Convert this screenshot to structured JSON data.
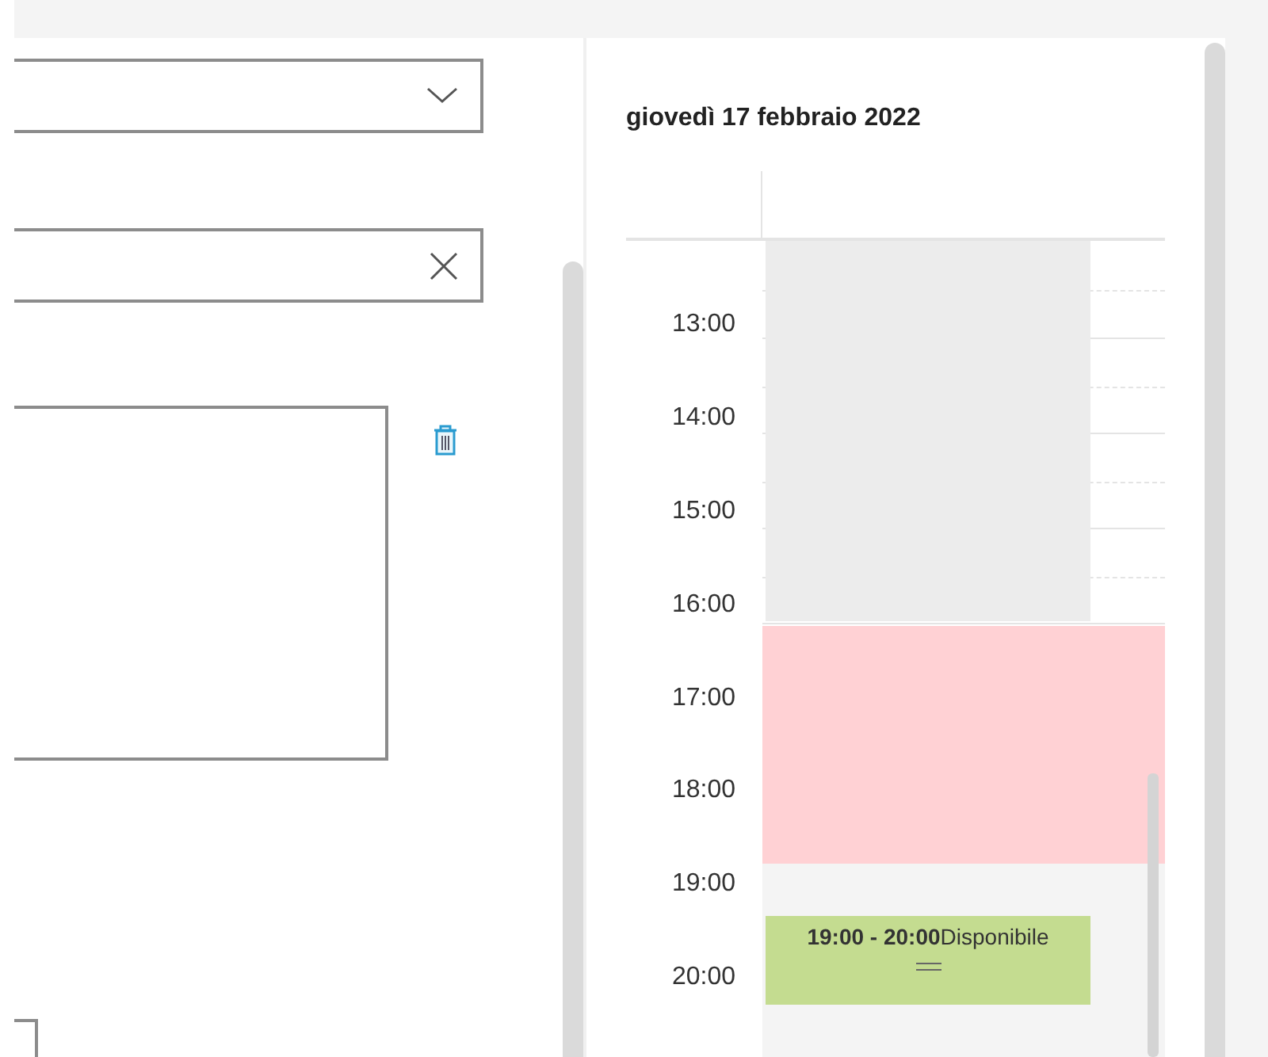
{
  "calendar": {
    "title": "giovedì 17 febbraio 2022",
    "hours": [
      "13:00",
      "14:00",
      "15:00",
      "16:00",
      "17:00",
      "18:00",
      "19:00",
      "20:00"
    ],
    "blocks": [
      {
        "kind": "unavailable"
      },
      {
        "kind": "blocked"
      },
      {
        "kind": "closed"
      },
      {
        "kind": "available",
        "time": "19:00 - 20:00",
        "label": "Disponibile"
      }
    ]
  }
}
